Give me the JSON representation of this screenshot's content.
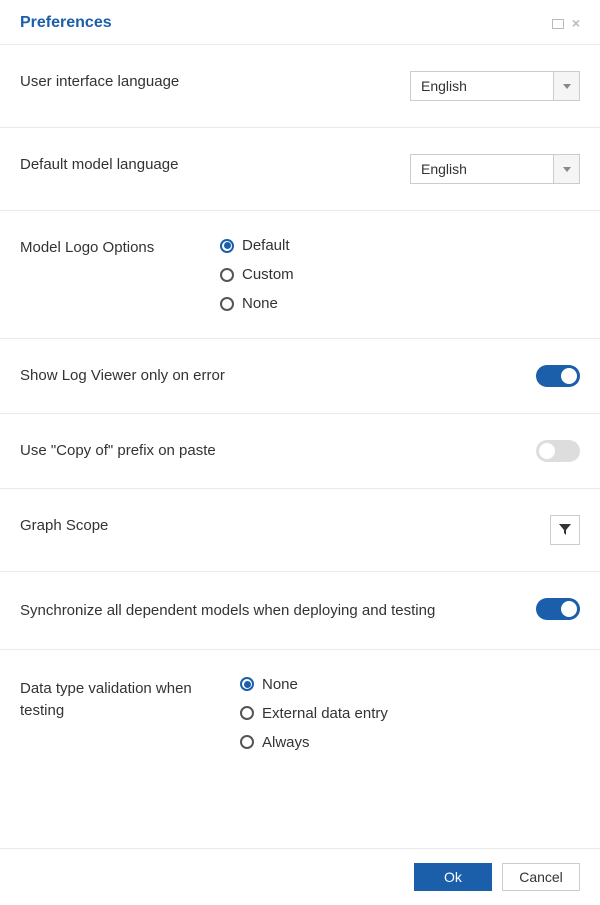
{
  "title": "Preferences",
  "sections": {
    "ui_lang": {
      "label": "User interface language",
      "value": "English"
    },
    "model_lang": {
      "label": "Default model language",
      "value": "English"
    },
    "logo": {
      "label": "Model Logo Options",
      "selected": "Default",
      "options": [
        "Default",
        "Custom",
        "None"
      ]
    },
    "log_viewer": {
      "label": "Show Log Viewer only on error",
      "on": true
    },
    "copy_prefix": {
      "label": "Use \"Copy of\" prefix on paste",
      "on": false
    },
    "graph_scope": {
      "label": "Graph Scope"
    },
    "sync_models": {
      "label": "Synchronize all dependent models when deploying and testing",
      "on": true
    },
    "validation": {
      "label": "Data type validation when testing",
      "selected": "None",
      "options": [
        "None",
        "External data entry",
        "Always"
      ]
    }
  },
  "buttons": {
    "ok": "Ok",
    "cancel": "Cancel"
  }
}
